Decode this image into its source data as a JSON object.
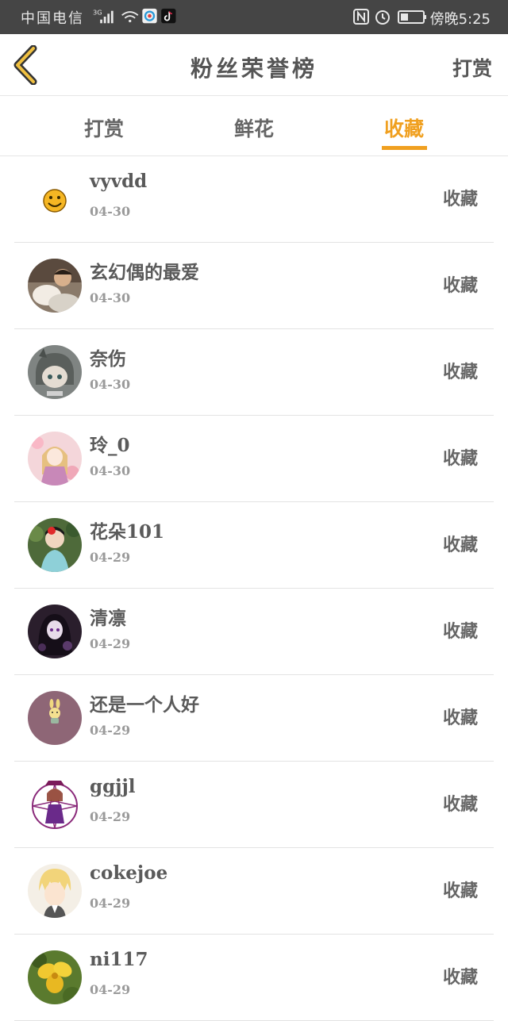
{
  "status_bar": {
    "carrier": "中国电信",
    "network": "3G",
    "time": "傍晚5:25"
  },
  "header": {
    "title": "粉丝荣誉榜",
    "action": "打赏"
  },
  "tabs": [
    {
      "label": "打赏",
      "active": false
    },
    {
      "label": "鲜花",
      "active": false
    },
    {
      "label": "收藏",
      "active": true
    }
  ],
  "colors": {
    "accent": "#f0a020",
    "status_bar_bg": "#454545"
  },
  "fans": [
    {
      "name": "vyvdd",
      "date": "04-30",
      "action": "收藏",
      "avatar": "smiley"
    },
    {
      "name": "玄幻偶的最爱",
      "date": "04-30",
      "action": "收藏",
      "avatar": "photo-dog"
    },
    {
      "name": "奈伤",
      "date": "04-30",
      "action": "收藏",
      "avatar": "anime-cat"
    },
    {
      "name": "玲_0",
      "date": "04-30",
      "action": "收藏",
      "avatar": "anime-girl-pink"
    },
    {
      "name": "花朵101",
      "date": "04-29",
      "action": "收藏",
      "avatar": "photo-flower-girl"
    },
    {
      "name": "清凛",
      "date": "04-29",
      "action": "收藏",
      "avatar": "anime-dark"
    },
    {
      "name": "还是一个人好",
      "date": "04-29",
      "action": "收藏",
      "avatar": "bunny-mauve"
    },
    {
      "name": "ggjjl",
      "date": "04-29",
      "action": "收藏",
      "avatar": "anime-magic-circle"
    },
    {
      "name": "cokejoe",
      "date": "04-29",
      "action": "收藏",
      "avatar": "anime-blond"
    },
    {
      "name": "ni117",
      "date": "04-29",
      "action": "收藏",
      "avatar": "photo-yellow-flower"
    }
  ]
}
